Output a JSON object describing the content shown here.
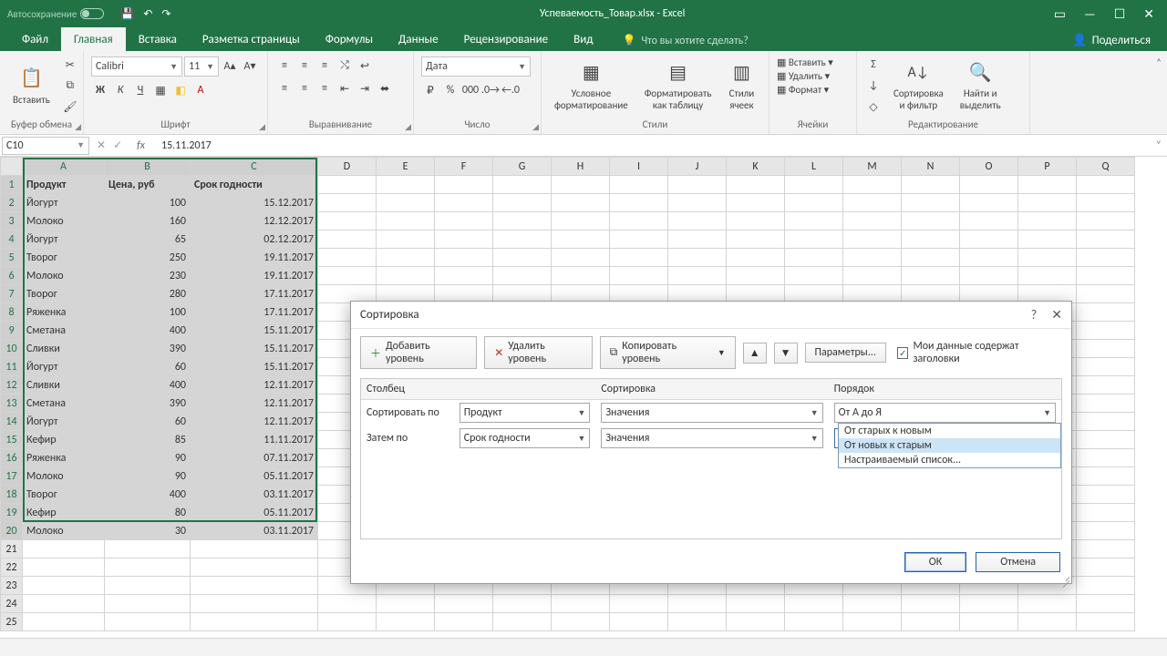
{
  "title": {
    "autosave": "Автосохранение",
    "doc": "Успеваемость_Товар.xlsx - Excel"
  },
  "tabs": {
    "file": "Файл",
    "home": "Главная",
    "insert": "Вставка",
    "layout": "Разметка страницы",
    "formulas": "Формулы",
    "data": "Данные",
    "review": "Рецензирование",
    "view": "Вид",
    "tell": "Что вы хотите сделать?",
    "share": "Поделиться"
  },
  "ribbon": {
    "paste": "Вставить",
    "clipboard": "Буфер обмена",
    "font_name": "Calibri",
    "font_size": "11",
    "font": "Шрифт",
    "alignment": "Выравнивание",
    "number_format": "Дата",
    "number": "Число",
    "cond_fmt": "Условное\nформатирование",
    "fmt_table": "Форматировать\nкак таблицу",
    "cell_style": "Стили\nячеек",
    "styles": "Стили",
    "ins": "Вставить",
    "del": "Удалить",
    "fmt": "Формат",
    "cells": "Ячейки",
    "sort": "Сортировка\nи фильтр",
    "find": "Найти и\nвыделить",
    "editing": "Редактирование"
  },
  "fbar": {
    "name": "C10",
    "value": "15.11.2017"
  },
  "headers": {
    "A": "A",
    "B": "B",
    "C": "C",
    "D": "D",
    "E": "E",
    "F": "F",
    "G": "G",
    "H": "H",
    "I": "I",
    "J": "J",
    "K": "K",
    "L": "L",
    "M": "M",
    "N": "N",
    "O": "O",
    "P": "P",
    "Q": "Q"
  },
  "data": {
    "h": {
      "A": "Продукт",
      "B": "Цена, руб",
      "C": "Срок годности"
    },
    "rows": [
      {
        "A": "Йогурт",
        "B": "100",
        "C": "15.12.2017"
      },
      {
        "A": "Молоко",
        "B": "160",
        "C": "12.12.2017"
      },
      {
        "A": "Йогурт",
        "B": "65",
        "C": "02.12.2017"
      },
      {
        "A": "Творог",
        "B": "250",
        "C": "19.11.2017"
      },
      {
        "A": "Молоко",
        "B": "230",
        "C": "19.11.2017"
      },
      {
        "A": "Творог",
        "B": "280",
        "C": "17.11.2017"
      },
      {
        "A": "Ряженка",
        "B": "100",
        "C": "17.11.2017"
      },
      {
        "A": "Сметана",
        "B": "400",
        "C": "15.11.2017"
      },
      {
        "A": "Сливки",
        "B": "390",
        "C": "15.11.2017"
      },
      {
        "A": "Йогурт",
        "B": "60",
        "C": "15.11.2017"
      },
      {
        "A": "Сливки",
        "B": "400",
        "C": "12.11.2017"
      },
      {
        "A": "Сметана",
        "B": "390",
        "C": "12.11.2017"
      },
      {
        "A": "Йогурт",
        "B": "60",
        "C": "12.11.2017"
      },
      {
        "A": "Кефир",
        "B": "85",
        "C": "11.11.2017"
      },
      {
        "A": "Ряженка",
        "B": "90",
        "C": "07.11.2017"
      },
      {
        "A": "Молоко",
        "B": "90",
        "C": "05.11.2017"
      },
      {
        "A": "Творог",
        "B": "400",
        "C": "03.11.2017"
      },
      {
        "A": "Кефир",
        "B": "80",
        "C": "05.11.2017"
      },
      {
        "A": "Молоко",
        "B": "30",
        "C": "03.11.2017"
      }
    ]
  },
  "dialog": {
    "title": "Сортировка",
    "add": "Добавить уровень",
    "del": "Удалить уровень",
    "copy": "Копировать уровень",
    "params": "Параметры...",
    "headers_chk": "Мои данные содержат заголовки",
    "col_h": "Столбец",
    "sort_h": "Сортировка",
    "order_h": "Порядок",
    "sortby": "Сортировать по",
    "thenby": "Затем по",
    "r1_col": "Продукт",
    "r1_sort": "Значения",
    "r1_order": "От А до Я",
    "r2_col": "Срок годности",
    "r2_sort": "Значения",
    "r2_order": "От старых к новым",
    "opt1": "От старых к новым",
    "opt2": "От новых к старым",
    "opt3": "Настраиваемый список...",
    "ok": "ОК",
    "cancel": "Отмена"
  }
}
